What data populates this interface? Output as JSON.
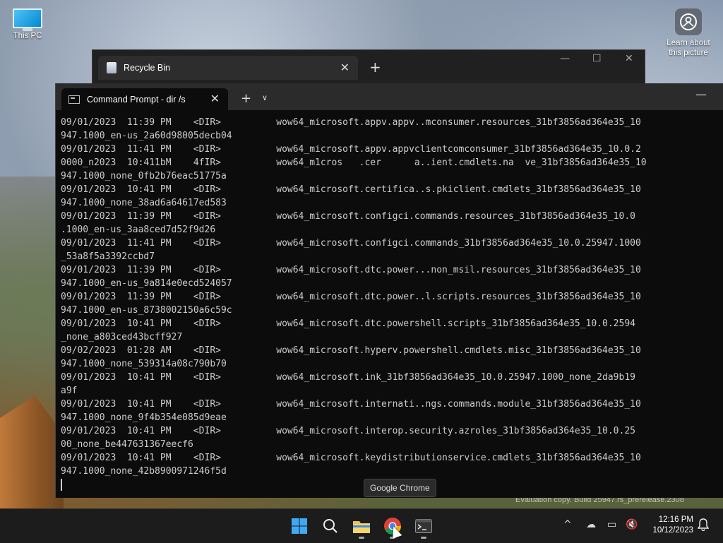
{
  "desktop": {
    "icons": [
      {
        "label": "This PC"
      },
      {
        "label": "Learn about this picture"
      }
    ],
    "watermark": "Evaluation copy. Build 25947.rs_prerelease.2308"
  },
  "recycle_bin_window": {
    "tab_title": "Recycle Bin"
  },
  "terminal": {
    "tab_title": "Command Prompt - dir  /s",
    "lines": [
      "09/01/2023  11:39 PM    <DIR>          wow64_microsoft.appv.appv..mconsumer.resources_31bf3856ad364e35_10",
      "947.1000_en-us_2a60d98005decb04",
      "09/01/2023  11:41 PM    <DIR>          wow64_microsoft.appv.appvclientcomconsumer_31bf3856ad364e35_10.0.2",
      "0000_n2023  10:411bM    4fIR>          wow64_m1cros   .cer      a..ient.cmdlets.na  ve_31bf3856ad364e35_10",
      "947.1000_none_0fb2b76eac51775a",
      "09/01/2023  10:41 PM    <DIR>          wow64_microsoft.certifica..s.pkiclient.cmdlets_31bf3856ad364e35_10",
      "947.1000_none_38ad6a64617ed583",
      "09/01/2023  11:39 PM    <DIR>          wow64_microsoft.configci.commands.resources_31bf3856ad364e35_10.0",
      ".1000_en-us_3aa8ced7d52f9d26",
      "09/01/2023  11:41 PM    <DIR>          wow64_microsoft.configci.commands_31bf3856ad364e35_10.0.25947.1000",
      "_53a8f5a3392ccbd7",
      "09/01/2023  11:39 PM    <DIR>          wow64_microsoft.dtc.power...non_msil.resources_31bf3856ad364e35_10",
      "947.1000_en-us_9a814e0ecd524057",
      "09/01/2023  11:39 PM    <DIR>          wow64_microsoft.dtc.power..l.scripts.resources_31bf3856ad364e35_10",
      "947.1000_en-us_8738002150a6c59c",
      "09/01/2023  10:41 PM    <DIR>          wow64_microsoft.dtc.powershell.scripts_31bf3856ad364e35_10.0.2594",
      "_none_a803ced43bcff927",
      "09/02/2023  01:28 AM    <DIR>          wow64_microsoft.hyperv.powershell.cmdlets.misc_31bf3856ad364e35_10",
      "947.1000_none_539314a08c790b70",
      "09/01/2023  10:41 PM    <DIR>          wow64_microsoft.ink_31bf3856ad364e35_10.0.25947.1000_none_2da9b19",
      "a9f",
      "09/01/2023  10:41 PM    <DIR>          wow64_microsoft.internati..ngs.commands.module_31bf3856ad364e35_10",
      "947.1000_none_9f4b354e085d9eae",
      "09/01/2023  10:41 PM    <DIR>          wow64_microsoft.interop.security.azroles_31bf3856ad364e35_10.0.25",
      "00_none_be447631367eecf6",
      "09/01/2023  10:41 PM    <DIR>          wow64_microsoft.keydistributionservice.cmdlets_31bf3856ad364e35_10",
      "947.1000_none_42b8900971246f5d"
    ]
  },
  "tooltip": "Google Chrome",
  "taskbar": {
    "time": "12:16 PM",
    "date": "10/12/2023"
  }
}
